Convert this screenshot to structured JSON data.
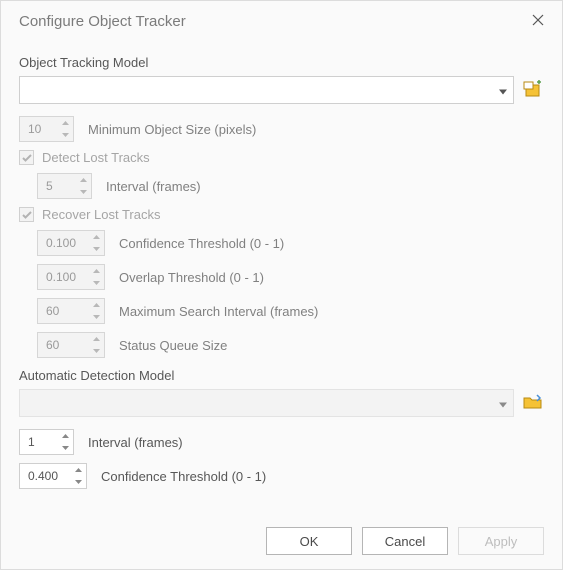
{
  "title": "Configure Object Tracker",
  "section1": {
    "label": "Object Tracking Model",
    "model_value": "",
    "min_size_value": "10",
    "min_size_label": "Minimum Object Size (pixels)"
  },
  "detect": {
    "checkbox_label": "Detect Lost Tracks",
    "checked": true,
    "interval_value": "5",
    "interval_label": "Interval (frames)"
  },
  "recover": {
    "checkbox_label": "Recover Lost Tracks",
    "checked": true,
    "conf_value": "0.100",
    "conf_label": "Confidence Threshold (0 - 1)",
    "overlap_value": "0.100",
    "overlap_label": "Overlap Threshold (0 - 1)",
    "max_search_value": "60",
    "max_search_label": "Maximum Search Interval (frames)",
    "queue_value": "60",
    "queue_label": "Status Queue Size"
  },
  "section2": {
    "label": "Automatic Detection Model",
    "model_value": "",
    "interval_value": "1",
    "interval_label": "Interval (frames)",
    "conf_value": "0.400",
    "conf_label": "Confidence Threshold (0 - 1)"
  },
  "buttons": {
    "ok": "OK",
    "cancel": "Cancel",
    "apply": "Apply"
  }
}
